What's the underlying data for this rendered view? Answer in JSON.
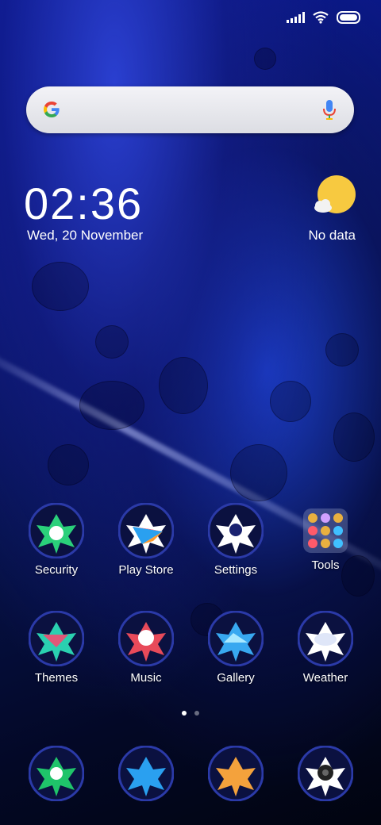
{
  "status_bar": {
    "signal_icon": "signal-icon",
    "wifi_icon": "wifi-icon",
    "battery_icon": "battery-icon"
  },
  "search": {
    "logo": "google-icon",
    "mic": "mic-icon"
  },
  "clock": {
    "time": "02:36",
    "date": "Wed, 20 November"
  },
  "weather": {
    "icon": "weather-sun-icon",
    "text": "No data"
  },
  "apps_row1": [
    {
      "label": "Security",
      "color": "#2ad07a"
    },
    {
      "label": "Play Store",
      "color": "#ff9a2e"
    },
    {
      "label": "Settings",
      "color": "#ffffff"
    },
    {
      "label": "Tools",
      "color": "#e8b040"
    }
  ],
  "apps_row2": [
    {
      "label": "Themes",
      "color": "#e05878"
    },
    {
      "label": "Music",
      "color": "#e84a5a"
    },
    {
      "label": "Gallery",
      "color": "#38a8f0"
    },
    {
      "label": "Weather",
      "color": "#e8eefc"
    }
  ],
  "dock": [
    {
      "name": "phone-icon",
      "color": "#1fc46a"
    },
    {
      "name": "messages-icon",
      "color": "#2aa0f0"
    },
    {
      "name": "browser-icon",
      "color": "#f4a23c"
    },
    {
      "name": "camera-icon",
      "color": "#ffffff"
    }
  ],
  "page_indicator": {
    "pages": 2,
    "current": 1
  }
}
